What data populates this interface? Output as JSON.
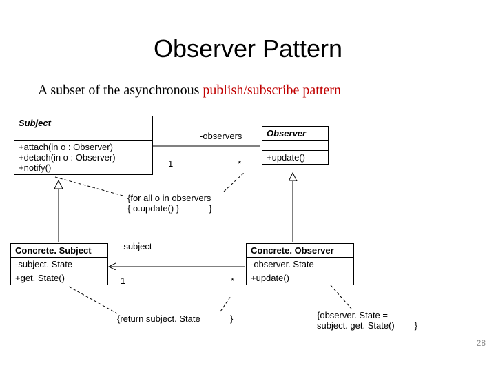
{
  "title": "Observer Pattern",
  "subtitle_prefix": "A subset of the asynchronous ",
  "subtitle_red": "publish/subscribe pattern",
  "page_number": "28",
  "classes": {
    "subject": {
      "name": "Subject",
      "attrs": "",
      "ops": "+attach(in o : Observer)\n+detach(in o : Observer)\n+notify()"
    },
    "observer": {
      "name": "Observer",
      "attrs": "",
      "ops": "+update()"
    },
    "concrete_subject": {
      "name": "Concrete. Subject",
      "attrs": "-subject. State",
      "ops": "+get. State()"
    },
    "concrete_observer": {
      "name": "Concrete. Observer",
      "attrs": "-observer. State",
      "ops": "+update()"
    }
  },
  "associations": {
    "observers_label": "-observers",
    "observers_mult_left": "1",
    "observers_mult_right": "*",
    "subject_label": "-subject",
    "subject_mult_left": "1",
    "subject_mult_right": "*"
  },
  "notes": {
    "notify_note": "{for all o in observers\n{ o.update() }            }",
    "getstate_note": "{return subject. State            }",
    "update_note": "{observer. State =\nsubject. get. State()        }"
  }
}
